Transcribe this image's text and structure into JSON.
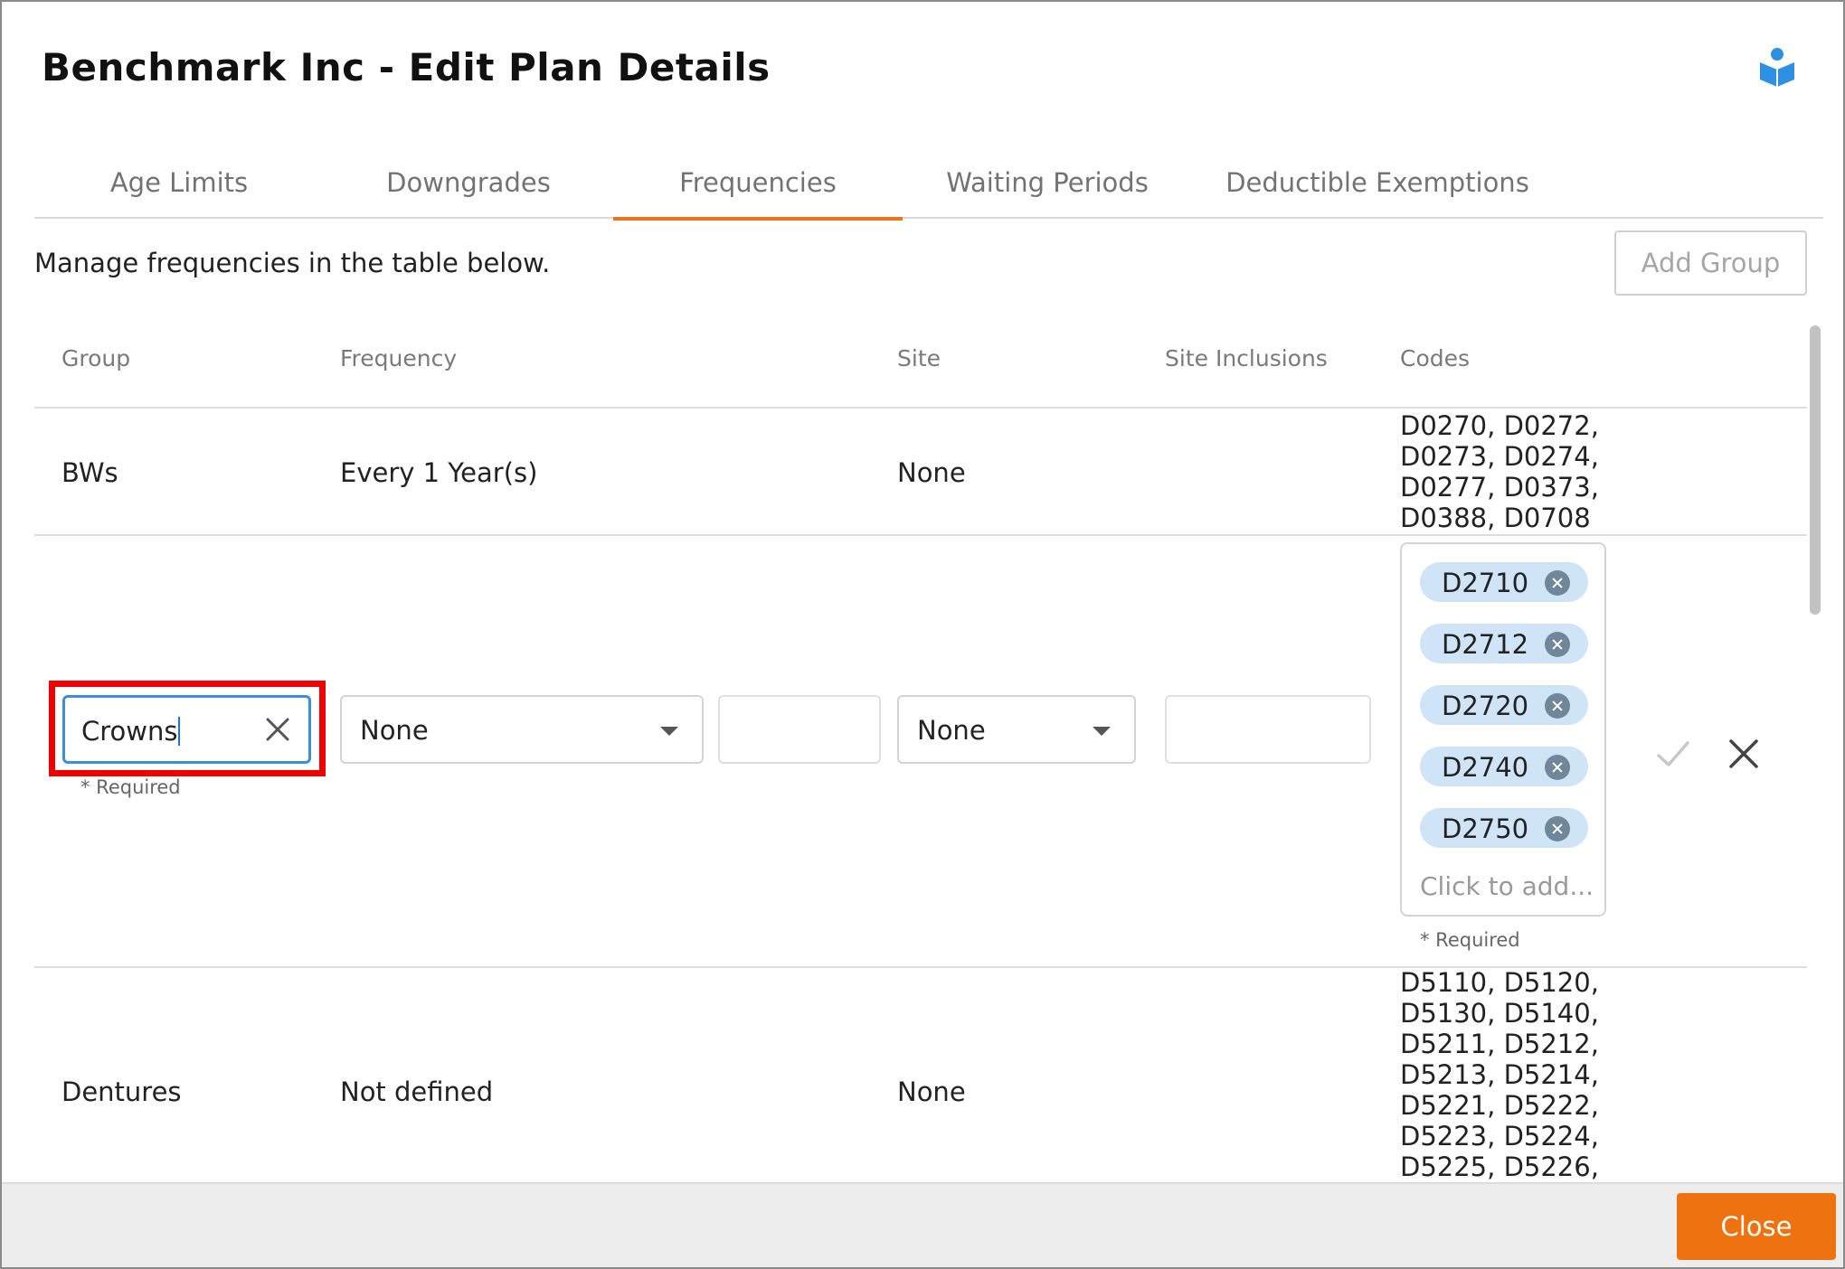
{
  "dialog": {
    "title": "Benchmark Inc - Edit Plan Details",
    "help_icon": "reader-icon"
  },
  "tabs": [
    {
      "label": "Age Limits",
      "active": false
    },
    {
      "label": "Downgrades",
      "active": false
    },
    {
      "label": "Frequencies",
      "active": true
    },
    {
      "label": "Waiting Periods",
      "active": false
    },
    {
      "label": "Deductible Exemptions",
      "active": false
    }
  ],
  "content": {
    "description": "Manage frequencies in the table below.",
    "add_group_label": "Add Group"
  },
  "table": {
    "headers": [
      "Group",
      "Frequency",
      "Site",
      "Site Inclusions",
      "Codes"
    ],
    "rows": [
      {
        "group": "BWs",
        "frequency": "Every 1 Year(s)",
        "site": "None",
        "codes": [
          "D0270, D0272,",
          "D0273, D0274,",
          "D0277, D0373,",
          "D0388, D0708"
        ]
      },
      {
        "group": "Dentures",
        "frequency": "Not defined",
        "site": "None",
        "codes": [
          "D5110, D5120,",
          "D5130, D5140,",
          "D5211, D5212,",
          "D5213, D5214,",
          "D5221, D5222,",
          "D5223, D5224,",
          "D5225, D5226,"
        ]
      }
    ]
  },
  "edit_row": {
    "group_value": "Crowns",
    "group_required": "* Required",
    "frequency_select": "None",
    "frequency_number": "",
    "site_select": "None",
    "site_inclusions": "",
    "code_tags": [
      "D2710",
      "D2712",
      "D2720",
      "D2740",
      "D2750"
    ],
    "codes_placeholder": "Click to add...",
    "codes_required": "* Required"
  },
  "footer": {
    "close_label": "Close"
  },
  "colors": {
    "accent": "#ee7417",
    "highlight": "#f20000",
    "focus": "#3b8fd9",
    "tag_bg": "#cfe4f7",
    "help_icon": "#2f8fe0"
  }
}
